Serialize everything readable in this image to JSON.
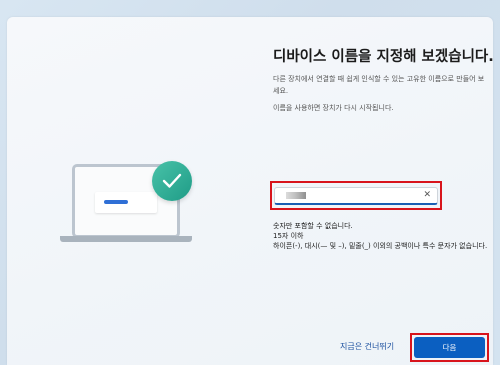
{
  "header": {
    "title": "디바이스 이름을 지정해 보겠습니다."
  },
  "main": {
    "description": "다른 장치에서 연결할 때 쉽게 인식할 수 있는 고유한 이름으로 만들어 보세요.",
    "restart_note": "이름을 사용하면 장치가 다시 시작됩니다.",
    "name_input": {
      "value": "",
      "placeholder": ""
    },
    "rules": [
      "숫자만 포함할 수 없습니다.",
      "15자 이하",
      "하이픈(-), 대시(— 및 –), 밑줄(_) 이외의 공백이나 특수 문자가 없습니다."
    ]
  },
  "footer": {
    "skip_label": "지금은 건너뛰기",
    "next_label": "다음"
  },
  "colors": {
    "accent": "#0b5fc1",
    "highlight_border": "#d8141c",
    "check_badge": "#1f9c87"
  },
  "icons": {
    "clear": "close-icon",
    "badge": "checkmark-icon"
  }
}
